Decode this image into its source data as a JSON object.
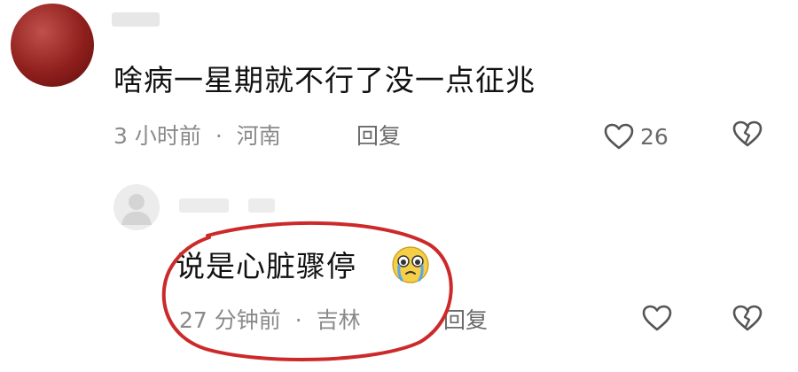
{
  "comment": {
    "text": "啥病一星期就不行了没一点征兆",
    "time": "3 小时前",
    "separator": "·",
    "location": "河南",
    "reply_label": "回复",
    "like_count": "26"
  },
  "reply": {
    "text": "说是心脏骤停",
    "emoji_icon": "crying-face-icon",
    "time": "27 分钟前",
    "separator": "·",
    "location": "吉林",
    "reply_label": "回复"
  },
  "colors": {
    "annotation": "#cc2a2a",
    "meta_gray": "#8a8a8a",
    "icon_gray": "#555555",
    "avatar_red": "#8f1f1c"
  }
}
